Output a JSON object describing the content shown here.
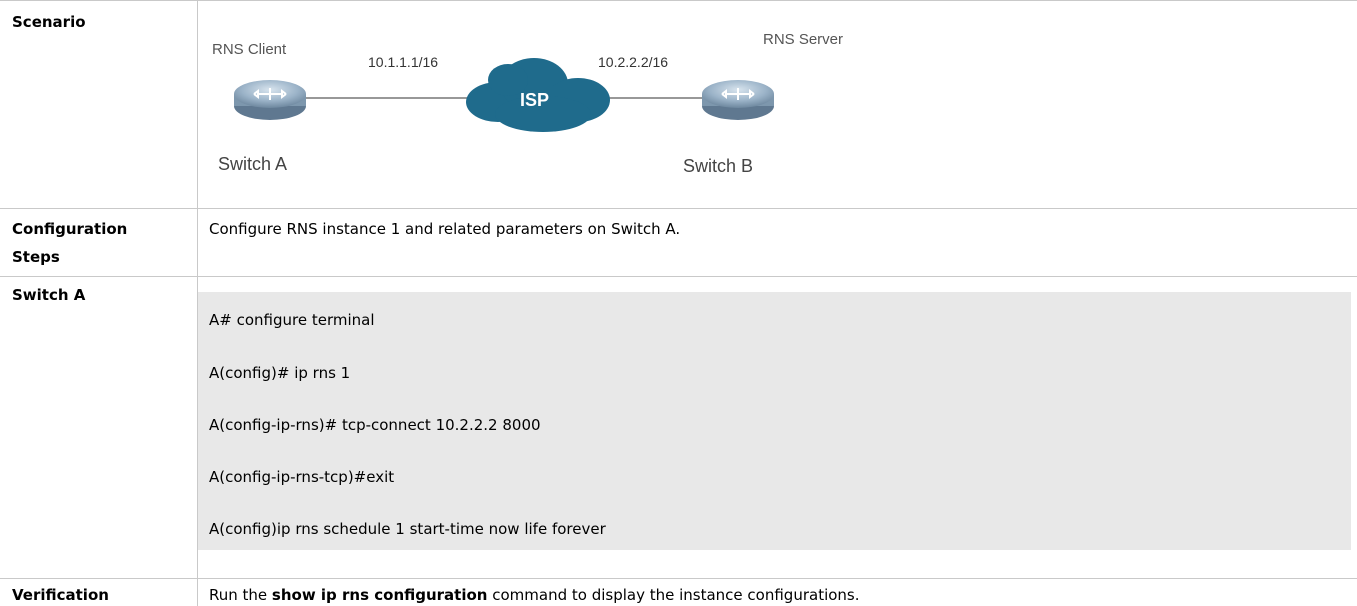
{
  "scenario": {
    "label": "Scenario",
    "diagram": {
      "client_label": "RNS Client",
      "client_ip": "10.1.1.1/16",
      "isp_label": "ISP",
      "server_ip": "10.2.2.2/16",
      "server_label": "RNS Server",
      "switch_a": "Switch A",
      "switch_b": "Switch B"
    }
  },
  "configuration_steps": {
    "label_line1": "Configuration",
    "label_line2": "Steps",
    "text": "Configure RNS instance 1 and related parameters on Switch A."
  },
  "switch_a": {
    "label": "Switch A",
    "code_lines": [
      "A# configure terminal",
      "A(config)# ip rns 1",
      "A(config-ip-rns)# tcp-connect 10.2.2.2 8000",
      "A(config-ip-rns-tcp)#exit",
      "A(config)ip rns schedule 1 start-time now life forever"
    ]
  },
  "verification": {
    "label": "Verification",
    "text_before": "Run the ",
    "command": "show ip rns configuration",
    "text_after": " command to display the instance configurations."
  },
  "colors": {
    "border": "#c9c9c9",
    "code_background": "#e8e8e8",
    "router_fill": "#8fa9bf",
    "cloud_fill": "#1f6b8c"
  }
}
